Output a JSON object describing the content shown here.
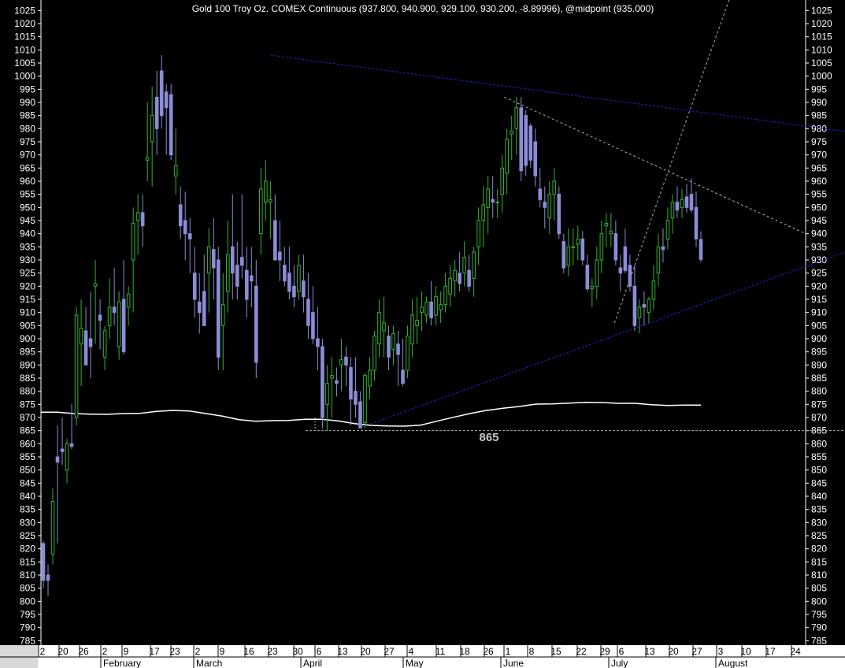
{
  "chart_data": {
    "type": "candlestick",
    "title": "Gold 100 Troy Oz. COMEX Continuous (937.800, 940.900, 929.100, 930.200, -8.89996), @midpoint (935.000)",
    "ylim": [
      783,
      1029
    ],
    "yticks": [
      785,
      790,
      795,
      800,
      805,
      810,
      815,
      820,
      825,
      830,
      835,
      840,
      845,
      850,
      855,
      860,
      865,
      870,
      875,
      880,
      885,
      890,
      895,
      900,
      905,
      910,
      915,
      920,
      925,
      930,
      935,
      940,
      945,
      950,
      955,
      960,
      965,
      970,
      975,
      980,
      985,
      990,
      995,
      1000,
      1005,
      1010,
      1015,
      1020,
      1025
    ],
    "x_day_labels": [
      "2",
      "20",
      "26",
      "2",
      "9",
      "17",
      "23",
      "2",
      "9",
      "16",
      "23",
      "30",
      "6",
      "13",
      "20",
      "27",
      "4",
      "11",
      "18",
      "26",
      "1",
      "8",
      "15",
      "22",
      "29",
      "6",
      "13",
      "20",
      "27",
      "3",
      "10",
      "17",
      "24"
    ],
    "x_month_labels": [
      "February",
      "March",
      "April",
      "May",
      "June",
      "July",
      "August"
    ],
    "annotation_text": "865",
    "colors": {
      "background": "#000000",
      "up_candle": "#2fb52f",
      "down_candle": "#8c8cd8",
      "trendline": "#2020d0",
      "projection": "#b0b0b0",
      "moving_average": "#ffffff",
      "axis_bg": "#ffffff"
    },
    "candles": [
      {
        "o": 822,
        "h": 823,
        "l": 805,
        "c": 808
      },
      {
        "o": 810,
        "h": 814,
        "l": 802,
        "c": 808
      },
      {
        "o": 818,
        "h": 843,
        "l": 814,
        "c": 838
      },
      {
        "o": 855,
        "h": 867,
        "l": 822,
        "c": 853
      },
      {
        "o": 858,
        "h": 870,
        "l": 852,
        "c": 857
      },
      {
        "o": 850,
        "h": 862,
        "l": 845,
        "c": 860
      },
      {
        "o": 860,
        "h": 875,
        "l": 858,
        "c": 859
      },
      {
        "o": 870,
        "h": 912,
        "l": 867,
        "c": 909
      },
      {
        "o": 898,
        "h": 915,
        "l": 882,
        "c": 904
      },
      {
        "o": 903,
        "h": 912,
        "l": 892,
        "c": 890
      },
      {
        "o": 900,
        "h": 918,
        "l": 885,
        "c": 897
      },
      {
        "o": 920,
        "h": 930,
        "l": 898,
        "c": 921
      },
      {
        "o": 909,
        "h": 915,
        "l": 896,
        "c": 907
      },
      {
        "o": 893,
        "h": 905,
        "l": 888,
        "c": 903
      },
      {
        "o": 905,
        "h": 923,
        "l": 900,
        "c": 912
      },
      {
        "o": 912,
        "h": 927,
        "l": 905,
        "c": 910
      },
      {
        "o": 897,
        "h": 918,
        "l": 892,
        "c": 914
      },
      {
        "o": 915,
        "h": 930,
        "l": 894,
        "c": 895
      },
      {
        "o": 912,
        "h": 920,
        "l": 905,
        "c": 917
      },
      {
        "o": 930,
        "h": 950,
        "l": 910,
        "c": 944
      },
      {
        "o": 945,
        "h": 955,
        "l": 932,
        "c": 948
      },
      {
        "o": 948,
        "h": 955,
        "l": 935,
        "c": 943
      },
      {
        "o": 968,
        "h": 990,
        "l": 960,
        "c": 969
      },
      {
        "o": 975,
        "h": 996,
        "l": 958,
        "c": 985
      },
      {
        "o": 992,
        "h": 1002,
        "l": 970,
        "c": 980
      },
      {
        "o": 1002,
        "h": 1008,
        "l": 980,
        "c": 985
      },
      {
        "o": 994,
        "h": 997,
        "l": 970,
        "c": 988
      },
      {
        "o": 993,
        "h": 997,
        "l": 968,
        "c": 970
      },
      {
        "o": 962,
        "h": 980,
        "l": 955,
        "c": 966
      },
      {
        "o": 951,
        "h": 958,
        "l": 938,
        "c": 943
      },
      {
        "o": 945,
        "h": 956,
        "l": 930,
        "c": 940
      },
      {
        "o": 940,
        "h": 946,
        "l": 925,
        "c": 938
      },
      {
        "o": 925,
        "h": 935,
        "l": 908,
        "c": 915
      },
      {
        "o": 914,
        "h": 925,
        "l": 902,
        "c": 910
      },
      {
        "o": 918,
        "h": 932,
        "l": 905,
        "c": 905
      },
      {
        "o": 925,
        "h": 942,
        "l": 910,
        "c": 935
      },
      {
        "o": 934,
        "h": 946,
        "l": 915,
        "c": 927
      },
      {
        "o": 930,
        "h": 935,
        "l": 888,
        "c": 893
      },
      {
        "o": 905,
        "h": 925,
        "l": 888,
        "c": 913
      },
      {
        "o": 918,
        "h": 945,
        "l": 910,
        "c": 932
      },
      {
        "o": 935,
        "h": 955,
        "l": 915,
        "c": 925
      },
      {
        "o": 928,
        "h": 937,
        "l": 915,
        "c": 920
      },
      {
        "o": 931,
        "h": 955,
        "l": 923,
        "c": 928
      },
      {
        "o": 926,
        "h": 935,
        "l": 908,
        "c": 915
      },
      {
        "o": 924,
        "h": 935,
        "l": 912,
        "c": 922
      },
      {
        "o": 920,
        "h": 930,
        "l": 885,
        "c": 891
      },
      {
        "o": 940,
        "h": 965,
        "l": 932,
        "c": 957
      },
      {
        "o": 952,
        "h": 968,
        "l": 945,
        "c": 960
      },
      {
        "o": 952,
        "h": 960,
        "l": 938,
        "c": 953
      },
      {
        "o": 945,
        "h": 955,
        "l": 935,
        "c": 930
      },
      {
        "o": 933,
        "h": 945,
        "l": 922,
        "c": 930
      },
      {
        "o": 928,
        "h": 935,
        "l": 920,
        "c": 922
      },
      {
        "o": 925,
        "h": 935,
        "l": 915,
        "c": 918
      },
      {
        "o": 920,
        "h": 928,
        "l": 912,
        "c": 916
      },
      {
        "o": 918,
        "h": 932,
        "l": 915,
        "c": 928
      },
      {
        "o": 922,
        "h": 932,
        "l": 910,
        "c": 916
      },
      {
        "o": 915,
        "h": 925,
        "l": 900,
        "c": 905
      },
      {
        "o": 910,
        "h": 920,
        "l": 898,
        "c": 900
      },
      {
        "o": 900,
        "h": 912,
        "l": 888,
        "c": 897
      },
      {
        "o": 897,
        "h": 900,
        "l": 866,
        "c": 870
      },
      {
        "o": 875,
        "h": 890,
        "l": 865,
        "c": 883
      },
      {
        "o": 885,
        "h": 893,
        "l": 870,
        "c": 886
      },
      {
        "o": 884,
        "h": 889,
        "l": 878,
        "c": 883
      },
      {
        "o": 890,
        "h": 900,
        "l": 880,
        "c": 892
      },
      {
        "o": 893,
        "h": 897,
        "l": 882,
        "c": 890
      },
      {
        "o": 889,
        "h": 893,
        "l": 867,
        "c": 877
      },
      {
        "o": 880,
        "h": 893,
        "l": 870,
        "c": 875
      },
      {
        "o": 876,
        "h": 880,
        "l": 866,
        "c": 866
      },
      {
        "o": 868,
        "h": 887,
        "l": 866,
        "c": 886
      },
      {
        "o": 882,
        "h": 893,
        "l": 877,
        "c": 888
      },
      {
        "o": 888,
        "h": 903,
        "l": 884,
        "c": 901
      },
      {
        "o": 898,
        "h": 915,
        "l": 893,
        "c": 910
      },
      {
        "o": 903,
        "h": 916,
        "l": 893,
        "c": 906
      },
      {
        "o": 901,
        "h": 905,
        "l": 888,
        "c": 893
      },
      {
        "o": 896,
        "h": 905,
        "l": 890,
        "c": 902
      },
      {
        "o": 898,
        "h": 903,
        "l": 882,
        "c": 894
      },
      {
        "o": 888,
        "h": 900,
        "l": 882,
        "c": 883
      },
      {
        "o": 888,
        "h": 905,
        "l": 885,
        "c": 901
      },
      {
        "o": 898,
        "h": 915,
        "l": 893,
        "c": 909
      },
      {
        "o": 905,
        "h": 916,
        "l": 898,
        "c": 907
      },
      {
        "o": 910,
        "h": 918,
        "l": 903,
        "c": 912
      },
      {
        "o": 909,
        "h": 916,
        "l": 906,
        "c": 914
      },
      {
        "o": 914,
        "h": 922,
        "l": 905,
        "c": 908
      },
      {
        "o": 909,
        "h": 920,
        "l": 905,
        "c": 916
      },
      {
        "o": 911,
        "h": 918,
        "l": 906,
        "c": 913
      },
      {
        "o": 913,
        "h": 925,
        "l": 910,
        "c": 920
      },
      {
        "o": 917,
        "h": 928,
        "l": 912,
        "c": 923
      },
      {
        "o": 922,
        "h": 930,
        "l": 916,
        "c": 926
      },
      {
        "o": 925,
        "h": 933,
        "l": 918,
        "c": 921
      },
      {
        "o": 925,
        "h": 937,
        "l": 920,
        "c": 931
      },
      {
        "o": 926,
        "h": 932,
        "l": 918,
        "c": 920
      },
      {
        "o": 923,
        "h": 935,
        "l": 916,
        "c": 933
      },
      {
        "o": 935,
        "h": 950,
        "l": 928,
        "c": 945
      },
      {
        "o": 945,
        "h": 958,
        "l": 935,
        "c": 951
      },
      {
        "o": 950,
        "h": 962,
        "l": 940,
        "c": 957
      },
      {
        "o": 953,
        "h": 962,
        "l": 946,
        "c": 952
      },
      {
        "o": 952,
        "h": 957,
        "l": 946,
        "c": 952
      },
      {
        "o": 955,
        "h": 970,
        "l": 948,
        "c": 965
      },
      {
        "o": 963,
        "h": 980,
        "l": 955,
        "c": 976
      },
      {
        "o": 978,
        "h": 985,
        "l": 968,
        "c": 979
      },
      {
        "o": 980,
        "h": 992,
        "l": 970,
        "c": 988
      },
      {
        "o": 988,
        "h": 992,
        "l": 960,
        "c": 964
      },
      {
        "o": 985,
        "h": 987,
        "l": 962,
        "c": 966
      },
      {
        "o": 981,
        "h": 982,
        "l": 965,
        "c": 968
      },
      {
        "o": 975,
        "h": 980,
        "l": 958,
        "c": 962
      },
      {
        "o": 957,
        "h": 965,
        "l": 950,
        "c": 953
      },
      {
        "o": 952,
        "h": 958,
        "l": 942,
        "c": 950
      },
      {
        "o": 946,
        "h": 960,
        "l": 940,
        "c": 955
      },
      {
        "o": 955,
        "h": 965,
        "l": 945,
        "c": 960
      },
      {
        "o": 955,
        "h": 958,
        "l": 938,
        "c": 940
      },
      {
        "o": 937,
        "h": 940,
        "l": 925,
        "c": 927
      },
      {
        "o": 928,
        "h": 942,
        "l": 924,
        "c": 935
      },
      {
        "o": 935,
        "h": 942,
        "l": 928,
        "c": 935
      },
      {
        "o": 936,
        "h": 943,
        "l": 930,
        "c": 938
      },
      {
        "o": 938,
        "h": 941,
        "l": 928,
        "c": 930
      },
      {
        "o": 928,
        "h": 932,
        "l": 918,
        "c": 919
      },
      {
        "o": 919,
        "h": 923,
        "l": 912,
        "c": 920
      },
      {
        "o": 920,
        "h": 935,
        "l": 915,
        "c": 930
      },
      {
        "o": 930,
        "h": 945,
        "l": 925,
        "c": 940
      },
      {
        "o": 943,
        "h": 948,
        "l": 935,
        "c": 944
      },
      {
        "o": 940,
        "h": 948,
        "l": 935,
        "c": 941
      },
      {
        "o": 940,
        "h": 945,
        "l": 928,
        "c": 930
      },
      {
        "o": 927,
        "h": 932,
        "l": 918,
        "c": 925
      },
      {
        "o": 935,
        "h": 942,
        "l": 925,
        "c": 926
      },
      {
        "o": 928,
        "h": 932,
        "l": 918,
        "c": 920
      },
      {
        "o": 920,
        "h": 928,
        "l": 903,
        "c": 905
      },
      {
        "o": 908,
        "h": 915,
        "l": 902,
        "c": 912
      },
      {
        "o": 913,
        "h": 918,
        "l": 905,
        "c": 912
      },
      {
        "o": 910,
        "h": 916,
        "l": 906,
        "c": 915
      },
      {
        "o": 915,
        "h": 928,
        "l": 911,
        "c": 922
      },
      {
        "o": 925,
        "h": 940,
        "l": 920,
        "c": 935
      },
      {
        "o": 935,
        "h": 942,
        "l": 929,
        "c": 934
      },
      {
        "o": 938,
        "h": 950,
        "l": 934,
        "c": 945
      },
      {
        "o": 946,
        "h": 955,
        "l": 940,
        "c": 952
      },
      {
        "o": 952,
        "h": 958,
        "l": 946,
        "c": 949
      },
      {
        "o": 950,
        "h": 957,
        "l": 946,
        "c": 953
      },
      {
        "o": 954,
        "h": 959,
        "l": 948,
        "c": 950
      },
      {
        "o": 955,
        "h": 961,
        "l": 948,
        "c": 949
      },
      {
        "o": 950,
        "h": 956,
        "l": 935,
        "c": 938
      },
      {
        "o": 937.8,
        "h": 940.9,
        "l": 929.1,
        "c": 930.2
      }
    ],
    "moving_average": [
      872,
      872,
      871.5,
      871.3,
      871.2,
      871.5,
      871.6,
      872.3,
      872.7,
      872.5,
      871.5,
      870.5,
      869.2,
      868.6,
      868.8,
      868.9,
      869.3,
      869.3,
      868.7,
      867.7,
      867.0,
      866.8,
      866.7,
      867.1,
      868.6,
      870.1,
      871.5,
      872.7,
      873.5,
      874.2,
      875.1,
      875.2,
      875.5,
      875.8,
      875.7,
      875.4,
      875.4,
      874.9,
      874.6,
      874.7,
      874.7
    ],
    "trendlines": [
      {
        "x1": 0.3,
        "y1": 1008,
        "x2": 1.0,
        "y2": 979
      },
      {
        "x1": 0.4165,
        "y1": 866,
        "x2": 1.0,
        "y2": 933
      },
      {
        "x1": 0.346,
        "y1": 865,
        "x2": 1.0,
        "y2": 865
      }
    ],
    "projections": [
      {
        "x1": 0.606,
        "y1": 992,
        "x2": 1.0,
        "y2": 940
      },
      {
        "x1": 0.75,
        "y1": 906,
        "x2": 0.901,
        "y2": 1030
      }
    ]
  }
}
